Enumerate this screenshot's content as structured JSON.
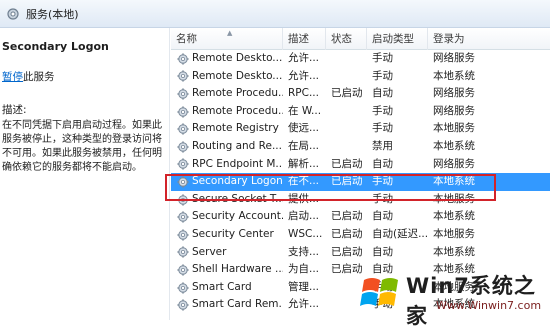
{
  "window": {
    "title": "服务(本地)",
    "icon": "services-icon"
  },
  "left_pane": {
    "service_name": "Secondary Logon",
    "stop_link": "暂停",
    "stop_suffix": "此服务",
    "description_label": "描述:",
    "description": "在不同凭据下启用启动过程。如果此服务被停止，这种类型的登录访问将不可用。如果此服务被禁用，任何明确依赖它的服务都将不能启动。"
  },
  "table": {
    "columns": [
      "名称",
      "描述",
      "状态",
      "启动类型",
      "登录为"
    ],
    "rows": [
      {
        "name": "Remote Deskto...",
        "desc": "允许...",
        "status": "",
        "startup": "手动",
        "logon": "网络服务"
      },
      {
        "name": "Remote Deskto...",
        "desc": "允许...",
        "status": "",
        "startup": "手动",
        "logon": "本地系统"
      },
      {
        "name": "Remote Procedu...",
        "desc": "RPC...",
        "status": "已启动",
        "startup": "自动",
        "logon": "网络服务"
      },
      {
        "name": "Remote Procedu...",
        "desc": "在 W...",
        "status": "",
        "startup": "手动",
        "logon": "网络服务"
      },
      {
        "name": "Remote Registry",
        "desc": "使远...",
        "status": "",
        "startup": "手动",
        "logon": "本地服务"
      },
      {
        "name": "Routing and Re...",
        "desc": "在局...",
        "status": "",
        "startup": "禁用",
        "logon": "本地系统"
      },
      {
        "name": "RPC Endpoint M...",
        "desc": "解析...",
        "status": "已启动",
        "startup": "自动",
        "logon": "网络服务"
      },
      {
        "name": "Secondary Logon",
        "desc": "在不...",
        "status": "已启动",
        "startup": "手动",
        "logon": "本地系统"
      },
      {
        "name": "Secure Socket T...",
        "desc": "提供...",
        "status": "",
        "startup": "手动",
        "logon": "本地服务"
      },
      {
        "name": "Security Account...",
        "desc": "启动...",
        "status": "已启动",
        "startup": "自动",
        "logon": "本地系统"
      },
      {
        "name": "Security Center",
        "desc": "WSC...",
        "status": "已启动",
        "startup": "自动(延迟...",
        "logon": "本地服务"
      },
      {
        "name": "Server",
        "desc": "支持...",
        "status": "已启动",
        "startup": "自动",
        "logon": "本地系统"
      },
      {
        "name": "Shell Hardware ...",
        "desc": "为自...",
        "status": "已启动",
        "startup": "自动",
        "logon": "本地系统"
      },
      {
        "name": "Smart Card",
        "desc": "管理...",
        "status": "",
        "startup": "手动",
        "logon": "本地服务"
      },
      {
        "name": "Smart Card Rem...",
        "desc": "允许...",
        "status": "",
        "startup": "手动",
        "logon": "本地系统"
      }
    ],
    "selected_index": 7
  },
  "watermark": {
    "brand": "Win7系统之家",
    "url": "Www.Winwin7.com"
  },
  "colors": {
    "selection": "#3399ff",
    "highlight_border": "#d2232a",
    "link": "#0066cc"
  }
}
